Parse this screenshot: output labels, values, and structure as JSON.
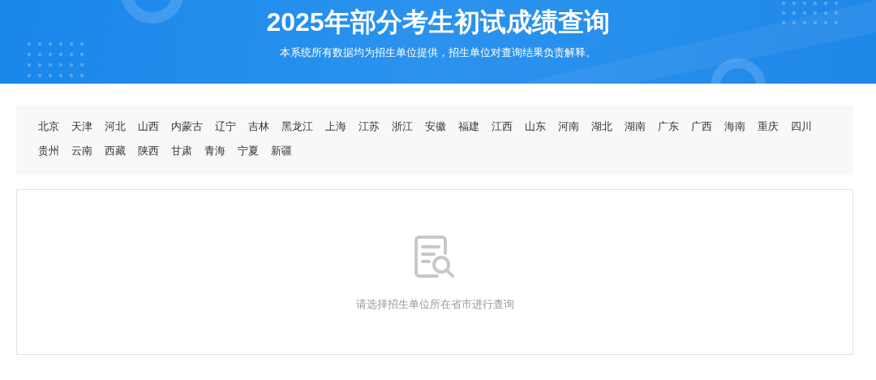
{
  "header": {
    "title": "2025年部分考生初试成绩查询",
    "subtitle": "本系统所有数据均为招生单位提供，招生单位对查询结果负责解释。"
  },
  "provinces": [
    "北京",
    "天津",
    "河北",
    "山西",
    "内蒙古",
    "辽宁",
    "吉林",
    "黑龙江",
    "上海",
    "江苏",
    "浙江",
    "安徽",
    "福建",
    "江西",
    "山东",
    "河南",
    "湖北",
    "湖南",
    "广东",
    "广西",
    "海南",
    "重庆",
    "四川",
    "贵州",
    "云南",
    "西藏",
    "陕西",
    "甘肃",
    "青海",
    "宁夏",
    "新疆"
  ],
  "result": {
    "message": "请选择招生单位所在省市进行查询"
  }
}
